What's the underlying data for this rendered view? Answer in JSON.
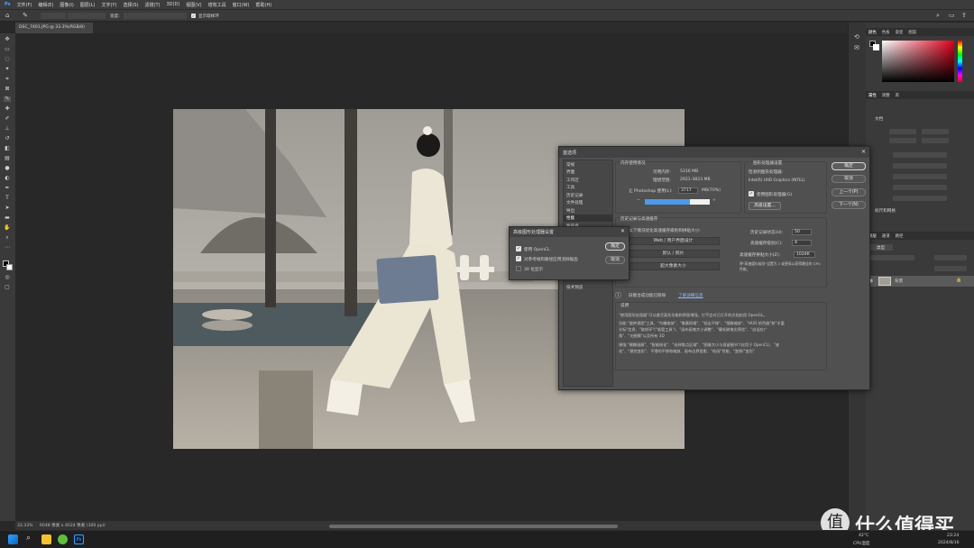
{
  "menu": [
    "文件(F)",
    "编辑(E)",
    "图像(I)",
    "图层(L)",
    "文字(Y)",
    "选择(S)",
    "滤镜(T)",
    "3D(D)",
    "视图(V)",
    "增效工具",
    "窗口(W)",
    "帮助(H)"
  ],
  "options": {
    "width_label": "宽度:",
    "height_label": "高度:",
    "show_sampling": "显示取样环"
  },
  "document_tab": "DSC_7401.JPG @ 33.3%(RGB/8)",
  "status": {
    "zoom": "33.33%",
    "doc_info": "6048 像素 x 4024 像素 (300 ppi)"
  },
  "panel_tabs": {
    "color": [
      "颜色",
      "色板",
      "渐变",
      "图案"
    ],
    "properties": [
      "属性",
      "调整",
      "库"
    ],
    "layers": [
      "图层",
      "通道",
      "路径"
    ]
  },
  "properties": {
    "doc_label": "文档",
    "rulers_label": "标尺和网格"
  },
  "layers": {
    "background_name": "背景",
    "kind_label": "类型"
  },
  "prefs": {
    "title": "首选项",
    "nav": [
      "常规",
      "界面",
      "工作区",
      "工具",
      "历史记录",
      "文件处理",
      "导出",
      "性能",
      "暂存盘",
      "光标",
      "透明度与色域",
      "单位与标尺",
      "参考线、网格和切片",
      "增效工具",
      "文字",
      "3D",
      "技术预览"
    ],
    "selected_index": 7,
    "memory_title": "内存使用情况",
    "avail_mem_label": "可用内存:",
    "avail_mem": "5316 MB",
    "ideal_range_label": "理想范围:",
    "ideal_range": "2921-3823 MB",
    "ps_use_label": "让 Photoshop 使用(L):",
    "ps_use_value": "3717",
    "ps_use_unit": "MB(70%)",
    "gpu_title": "图形处理器设置",
    "gpu_detect_label": "检测到图形处理器:",
    "gpu_name": "Intel(R) UHD Graphics (INTEL)",
    "gpu_use": "使用图形处理器(G)",
    "advanced_btn": "高级设置...",
    "history_title": "历史记录与高速缓存",
    "optimize_label": "针对以下情况优化高速缓存级别和拼贴大小:",
    "opt_buttons": [
      "Web / 用户界面设计",
      "默认 / 照片",
      "超大像素大小"
    ],
    "history_states_label": "历史记录状态(H):",
    "history_states": "50",
    "cache_levels_label": "高速缓存级别(C):",
    "cache_levels": "4",
    "tile_size_label": "高速缓存拼贴大小(Z):",
    "tile_size": "1024K",
    "cache_note": "将\"高速缓存级别\"设置为 2 或更高以获得最佳的 GPU 性能。",
    "info_text": "旧版合成功能已移除",
    "info_link": "了解详细信息",
    "desc_title": "说明",
    "desc_lines": [
      "\"使用图形处理器\"可以激活某些功能和界面增强。它不会对已打开的文档启用 OpenGL。",
      "功能:\"旋转视图\"工具、\"鸟瞰缩放\"、\"像素网格\"、\"轻击平移\"、\"细微缩放\"、\"HUD 拾色器\"和\"丰富",
      "光标\"信息、\"取样环\"(\"吸管工具\")、\"画布画笔大小调整\"、\"硬毛刷笔尖预览\"、\"自适应广",
      "角\"、\"光圈模\"以及所有 3D",
      "增强:\"模糊画廊\"、\"智能锐化\"、\"选择焦点区域\"、\"图像大小与保留细节\"(仅用于 OpenCL)、\"液",
      "化\"、\"操控变形\"、平滑的平移和缩放、画布边界投影、\"绘画\"性能、\"变换/\"变形\""
    ],
    "ok": "确定",
    "cancel": "取消",
    "prev": "上一个(P)",
    "next": "下一个(N)"
  },
  "gpu_dialog": {
    "title": "高级图形处理器设置",
    "use_opencl": "使用 OpenCL",
    "antialias": "对参考线和路径应用消除锯齿",
    "display_30bit": "30 位显示",
    "ok": "确定",
    "cancel": "取消"
  },
  "taskbar": {
    "temp": "42°C",
    "cpu": "CPU温度",
    "time": "23:24",
    "date": "2024/8/16"
  },
  "watermark": "什么值得买"
}
